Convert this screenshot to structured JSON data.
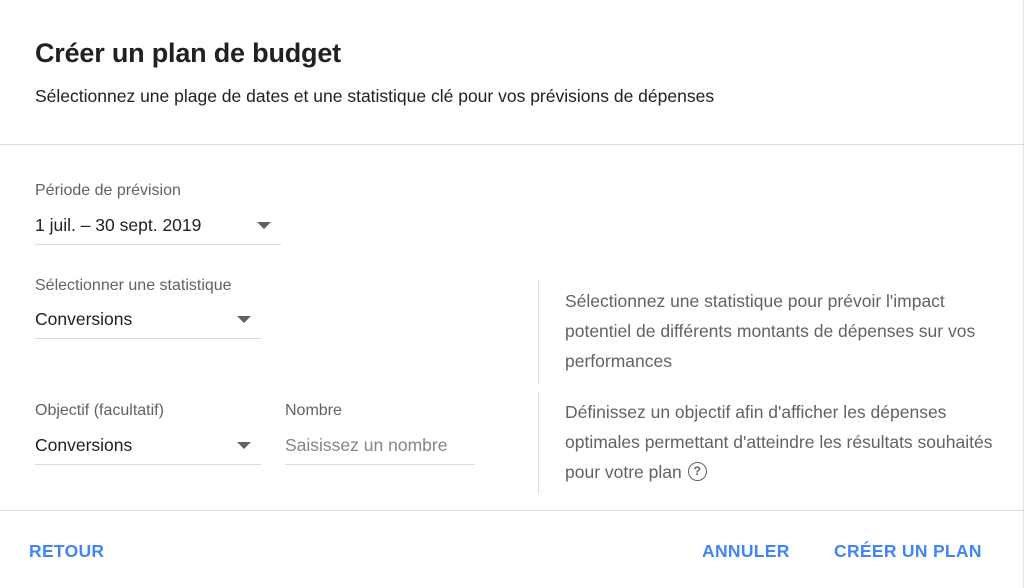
{
  "dialog": {
    "title": "Créer un plan de budget",
    "subtitle": "Sélectionnez une plage de dates et une statistique clé pour vos prévisions de dépenses"
  },
  "period": {
    "label": "Période de prévision",
    "value": "1 juil. – 30 sept. 2019"
  },
  "statistic": {
    "label": "Sélectionner une statistique",
    "value": "Conversions",
    "help": "Sélectionnez une statistique pour prévoir l'impact potentiel de différents montants de dépenses sur vos performances"
  },
  "objective": {
    "label": "Objectif (facultatif)",
    "value": "Conversions",
    "help": "Définissez un objectif afin d'afficher les dépenses optimales permettant d'atteindre les résultats souhaités pour votre plan"
  },
  "number": {
    "label": "Nombre",
    "value": "",
    "placeholder": "Saisissez un nombre"
  },
  "footer": {
    "back": "RETOUR",
    "cancel": "ANNULER",
    "create": "CRÉER UN PLAN"
  },
  "icons": {
    "help": "help-circle-icon",
    "dropdown": "triangle-down-icon"
  },
  "colors": {
    "accent": "#4285f4",
    "text": "#202124",
    "secondary_text": "#5f6368",
    "divider": "#dadce0"
  }
}
